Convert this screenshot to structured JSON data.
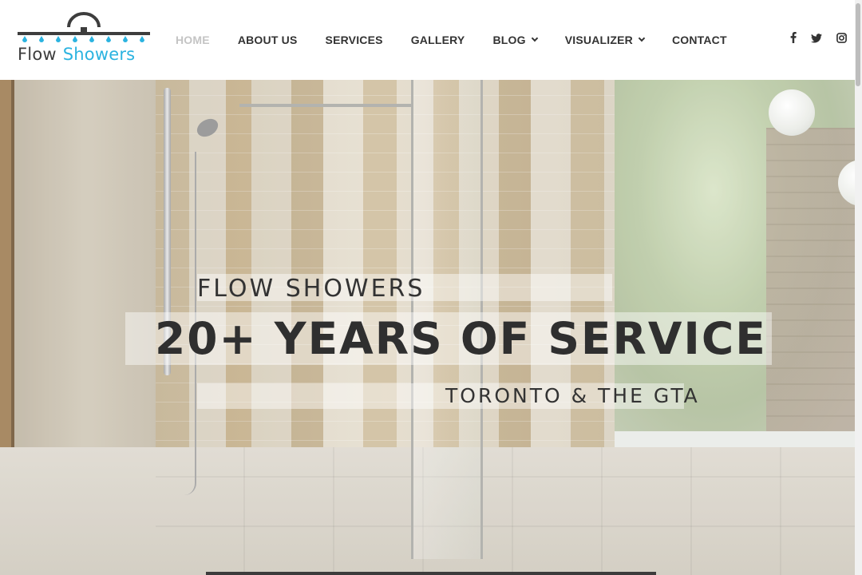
{
  "logo": {
    "word1": "Flow",
    "word2": "Showers",
    "colors": {
      "gray": "#3d3d3d",
      "blue": "#2bb3e0"
    }
  },
  "nav": {
    "items": [
      {
        "label": "HOME",
        "active": true
      },
      {
        "label": "ABOUT US"
      },
      {
        "label": "SERVICES"
      },
      {
        "label": "GALLERY"
      },
      {
        "label": "BLOG",
        "dropdown": true
      },
      {
        "label": "VISUALIZER",
        "dropdown": true
      },
      {
        "label": "CONTACT"
      }
    ]
  },
  "social": {
    "icons": [
      "facebook-icon",
      "twitter-icon",
      "instagram-icon"
    ]
  },
  "hero": {
    "brand": "FLOW SHOWERS",
    "headline": "20+ YEARS OF SERVICE",
    "location": "TORONTO & THE GTA"
  },
  "colors": {
    "nav_text": "#333333",
    "nav_active": "#c4c4c4",
    "headline": "#2f2f2f"
  }
}
